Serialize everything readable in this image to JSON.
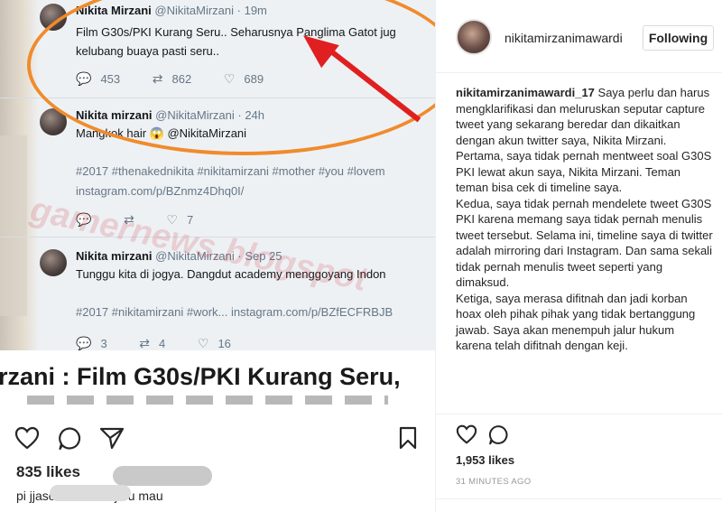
{
  "post_image": {
    "tweets": [
      {
        "name": "Nikita Mirzani",
        "handle": "@NikitaMirzani",
        "time": "· 19m",
        "lines": [
          "Film G30s/PKI Kurang Seru.. Seharusnya Panglima Gatot jug",
          "kelubang buaya pasti seru.."
        ],
        "replies": "453",
        "retweets": "862",
        "likes": "689"
      },
      {
        "name": "Nikita mirzani",
        "handle": "@NikitaMirzani",
        "time": "· 24h",
        "lines": [
          "Mangkok hair 😱 @NikitaMirzani"
        ],
        "hashtags": "#2017 #thenakednikita #nikitamirzani #mother #you #lovem",
        "link": "instagram.com/p/BZnmz4Dhq0I/",
        "likes": "7"
      },
      {
        "name": "Nikita mirzani",
        "handle": "@NikitaMirzani",
        "time": "· Sep 25",
        "lines": [
          "Tunggu kita di jogya. Dangdut academy menggoyang Indon"
        ],
        "hashtags_link": "#2017 #nikitamirzani #work... instagram.com/p/BZfECFRBJB",
        "replies": "3",
        "retweets": "4",
        "likes": "16"
      }
    ],
    "watermark": "gamernews.blogspot",
    "headline": "rzani : Film G30s/PKI Kurang Seru,",
    "likes_label": "835 likes",
    "comment_visible": "pi             jjasorn masih aja u mau"
  },
  "header": {
    "username": "nikitamirzanimawardi",
    "follow_label": "Following"
  },
  "caption": {
    "username": "nikitamirzanimawardi_17",
    "paragraphs": [
      "Saya perlu dan harus mengklarifikasi dan meluruskan seputar capture tweet yang sekarang beredar dan dikaitkan dengan akun twitter saya, Nikita Mirzani.",
      "Pertama, saya tidak pernah mentweet soal G30S PKI lewat akun saya, Nikita Mirzani. Teman teman bisa cek di timeline saya.",
      "Kedua, saya tidak pernah mendelete tweet G30S PKI karena memang saya tidak pernah menulis tweet tersebut. Selama ini, timeline saya di twitter adalah mirroring dari Instagram. Dan sama sekali tidak pernah menulis tweet seperti yang dimaksud.",
      "Ketiga, saya merasa difitnah dan jadi korban hoax oleh pihak pihak yang tidak bertanggung jawab. Saya akan menempuh jalur hukum karena telah difitnah dengan keji."
    ]
  },
  "footer": {
    "likes": "1,953 likes",
    "timestamp": "31 MINUTES AGO"
  },
  "icons": {
    "heart": "heart-icon",
    "comment": "comment-icon",
    "share": "share-icon",
    "bookmark": "bookmark-icon"
  },
  "colors": {
    "highlight_ring": "#f08b2c",
    "arrow": "#e02020",
    "link_blue": "#2b6aa8"
  }
}
